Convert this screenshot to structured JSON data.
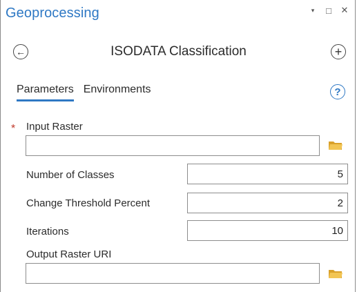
{
  "pane": {
    "title": "Geoprocessing",
    "controls": {
      "dropdown": "▾",
      "maximize": "□",
      "close": "✕"
    }
  },
  "tool": {
    "back_icon": "←",
    "title": "ISODATA Classification",
    "add_icon": "+"
  },
  "tabs": [
    {
      "label": "Parameters",
      "active": true
    },
    {
      "label": "Environments",
      "active": false
    }
  ],
  "help_icon": "?",
  "params": {
    "required_marker": "*",
    "input_raster": {
      "label": "Input Raster",
      "value": ""
    },
    "num_classes": {
      "label": "Number of Classes",
      "value": "5"
    },
    "change_threshold": {
      "label": "Change Threshold Percent",
      "value": "2"
    },
    "iterations": {
      "label": "Iterations",
      "value": "10"
    },
    "output_raster": {
      "label": "Output Raster URI",
      "value": ""
    }
  },
  "colors": {
    "accent": "#2e78c4",
    "required": "#c0392b",
    "folder": "#e8b43a"
  }
}
